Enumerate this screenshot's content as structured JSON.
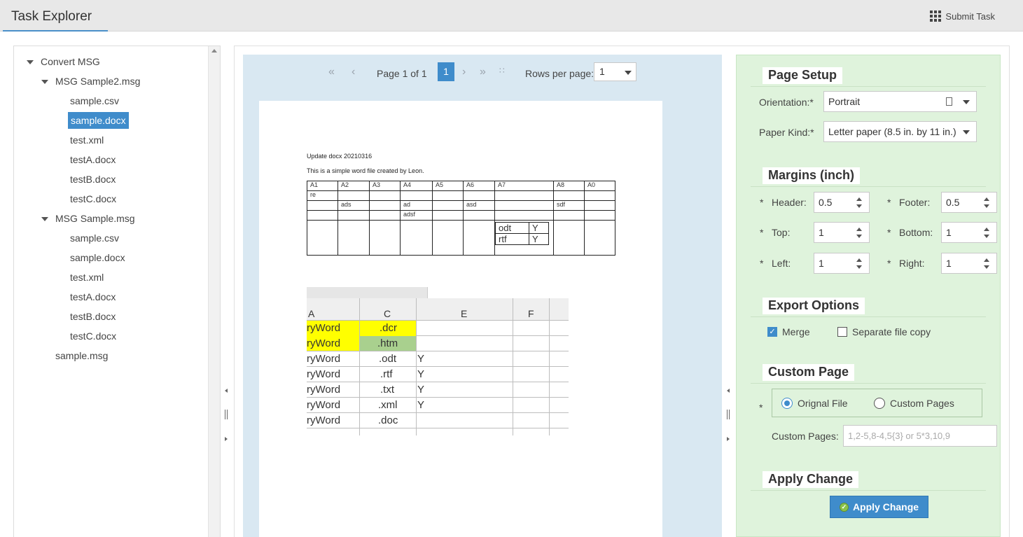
{
  "header": {
    "title": "Task Explorer",
    "submit_label": "Submit Task"
  },
  "tree": {
    "items": [
      {
        "label": "Convert MSG"
      },
      {
        "label": "MSG Sample2.msg"
      },
      {
        "label": "sample.csv"
      },
      {
        "label": "sample.docx"
      },
      {
        "label": "test.xml"
      },
      {
        "label": "testA.docx"
      },
      {
        "label": "testB.docx"
      },
      {
        "label": "testC.docx"
      },
      {
        "label": "MSG Sample.msg"
      },
      {
        "label": "sample.csv"
      },
      {
        "label": "sample.docx"
      },
      {
        "label": "test.xml"
      },
      {
        "label": "testA.docx"
      },
      {
        "label": "testB.docx"
      },
      {
        "label": "testC.docx"
      },
      {
        "label": "sample.msg"
      }
    ],
    "selected": "sample.docx"
  },
  "pager": {
    "page_text": "Page 1 of 1",
    "current_page": "1",
    "rows_label": "Rows per page:",
    "rows_value": "1"
  },
  "document": {
    "line1": "Update docx 20210316",
    "line2": "This is a simple word file created by Leon.",
    "table": {
      "header": [
        "A1",
        "A2",
        "A3",
        "A4",
        "A5",
        "A6",
        "A7",
        "A8",
        "A0"
      ],
      "row1": [
        "re",
        "",
        "",
        "",
        "",
        "",
        "",
        "",
        ""
      ],
      "row2": [
        "",
        "ads",
        "",
        "ad",
        "",
        "asd",
        "",
        "sdf",
        ""
      ],
      "row3": [
        "",
        "",
        "",
        "adsf",
        "",
        "",
        "",
        "",
        ""
      ],
      "nested": [
        [
          "odt",
          "Y"
        ],
        [
          "rtf",
          "Y"
        ]
      ]
    },
    "excel": {
      "columns": [
        "A",
        "C",
        "E",
        "F"
      ],
      "rows": [
        [
          "ryWord",
          ".dcr",
          ""
        ],
        [
          "ryWord",
          ".htm",
          ""
        ],
        [
          "ryWord",
          ".odt",
          "Y"
        ],
        [
          "ryWord",
          ".rtf",
          "Y"
        ],
        [
          "ryWord",
          ".txt",
          "Y"
        ],
        [
          "ryWord",
          ".xml",
          "Y"
        ],
        [
          "ryWord",
          ".doc",
          ""
        ]
      ],
      "highlight_yellow": "#ffff00",
      "highlight_green": "#a9d08e"
    }
  },
  "settings": {
    "page_setup": {
      "title": "Page Setup",
      "orientation_label": "Orientation:*",
      "orientation_value": "Portrait",
      "paper_label": "Paper Kind:*",
      "paper_value": "Letter paper (8.5 in. by 11 in.)"
    },
    "margins": {
      "title": "Margins (inch)",
      "header_label": "Header:",
      "header_value": "0.5",
      "footer_label": "Footer:",
      "footer_value": "0.5",
      "top_label": "Top:",
      "top_value": "1",
      "bottom_label": "Bottom:",
      "bottom_value": "1",
      "left_label": "Left:",
      "left_value": "1",
      "right_label": "Right:",
      "right_value": "1",
      "required_mark": "*"
    },
    "export": {
      "title": "Export Options",
      "merge_label": "Merge",
      "merge_checked": true,
      "separate_label": "Separate file copy",
      "separate_checked": false
    },
    "custom_page": {
      "title": "Custom Page",
      "original_label": "Orignal File",
      "custom_label": "Custom Pages",
      "selected": "original",
      "pages_label": "Custom Pages:",
      "pages_placeholder": "1,2-5,8-4,5{3} or 5*3,10,9"
    },
    "apply": {
      "title": "Apply Change",
      "button_label": "Apply Change"
    }
  },
  "colors": {
    "accent": "#3f8ccb",
    "preview_bg": "#d9e8f2",
    "settings_bg": "#dff3dc"
  }
}
